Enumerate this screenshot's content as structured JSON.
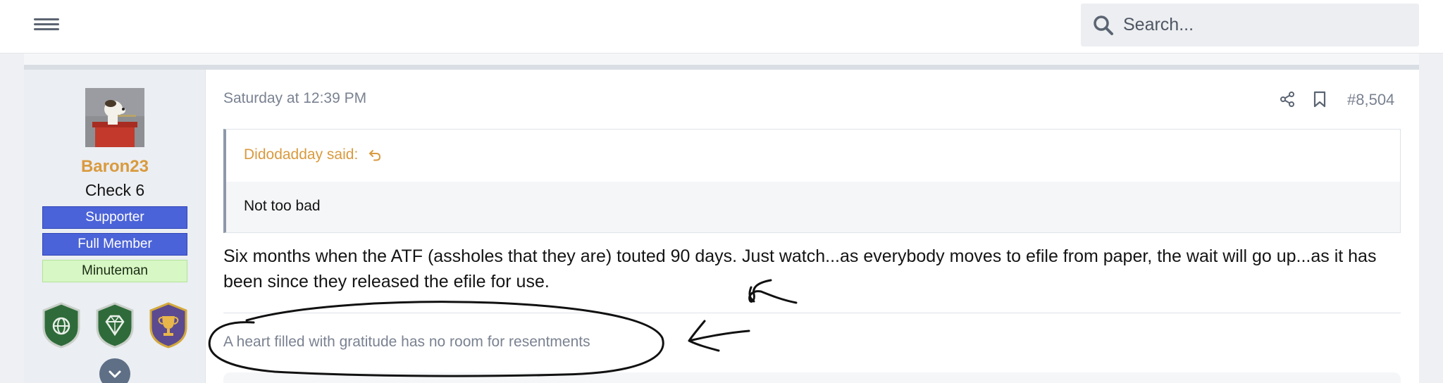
{
  "header": {
    "menu_icon": "hamburger-menu-icon",
    "search": {
      "placeholder": "Search...",
      "icon": "search-icon"
    }
  },
  "user": {
    "name": "Baron23",
    "title": "Check 6",
    "banners": [
      "Supporter",
      "Full Member",
      "Minuteman"
    ],
    "trophies": [
      "grenade-globe-icon",
      "diamond-icon",
      "trophy-cup-icon"
    ]
  },
  "post": {
    "date": "Saturday at 12:39 PM",
    "number": "#8,504",
    "quote": {
      "author_label": "Didodadday said:",
      "text": "Not too bad"
    },
    "message": "Six months when the ATF (assholes that they are) touted 90 days. Just watch...as everybody moves to efile from paper, the wait will go up...as it has been since they released the efile for use.",
    "signature": "A heart filled with gratitude has no room for resentments"
  },
  "colors": {
    "accent_orange": "#d99a3e",
    "banner_blue": "#4b63d8",
    "banner_green": "#d7f7c4",
    "muted_text": "#7a8291"
  }
}
